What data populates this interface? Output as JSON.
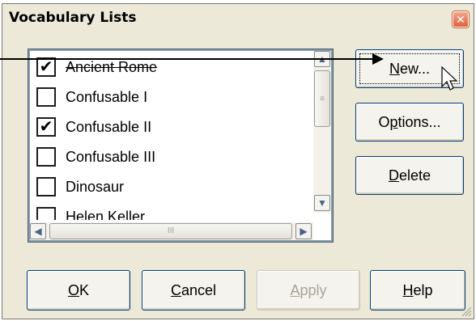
{
  "dialog": {
    "title": "Vocabulary Lists",
    "close_glyph": "✕"
  },
  "list": {
    "items": [
      {
        "label": "Ancient Rome",
        "checked": true
      },
      {
        "label": "Confusable I",
        "checked": false
      },
      {
        "label": "Confusable II",
        "checked": true
      },
      {
        "label": "Confusable III",
        "checked": false
      },
      {
        "label": "Dinosaur",
        "checked": false
      },
      {
        "label": "Helen Keller",
        "checked": false
      }
    ],
    "check_glyph": "✔"
  },
  "scroll": {
    "up": "▲",
    "down": "▼",
    "left": "◀",
    "right": "▶",
    "grip": "≡",
    "hgrip": "III"
  },
  "buttons": {
    "new_pre": "",
    "new_u": "N",
    "new_post": "ew...",
    "options_pre": "O",
    "options_u": "p",
    "options_post": "tions...",
    "delete_pre": "",
    "delete_u": "D",
    "delete_post": "elete",
    "ok_pre": "",
    "ok_u": "O",
    "ok_post": "K",
    "cancel_pre": "",
    "cancel_u": "C",
    "cancel_post": "ancel",
    "apply_pre": "",
    "apply_u": "A",
    "apply_post": "pply",
    "help_pre": "",
    "help_u": "H",
    "help_post": "elp"
  },
  "colors": {
    "dialog_bg": "#ece9d8",
    "list_border": "#7f9db9",
    "button_border": "#003c74",
    "close_button": "#e0603c",
    "disabled_text": "#a8a497"
  },
  "icons": [
    "close-icon",
    "checkmark-icon",
    "scroll-up-icon",
    "scroll-down-icon",
    "scroll-left-icon",
    "scroll-right-icon",
    "cursor-icon",
    "resize-grip-icon"
  ]
}
